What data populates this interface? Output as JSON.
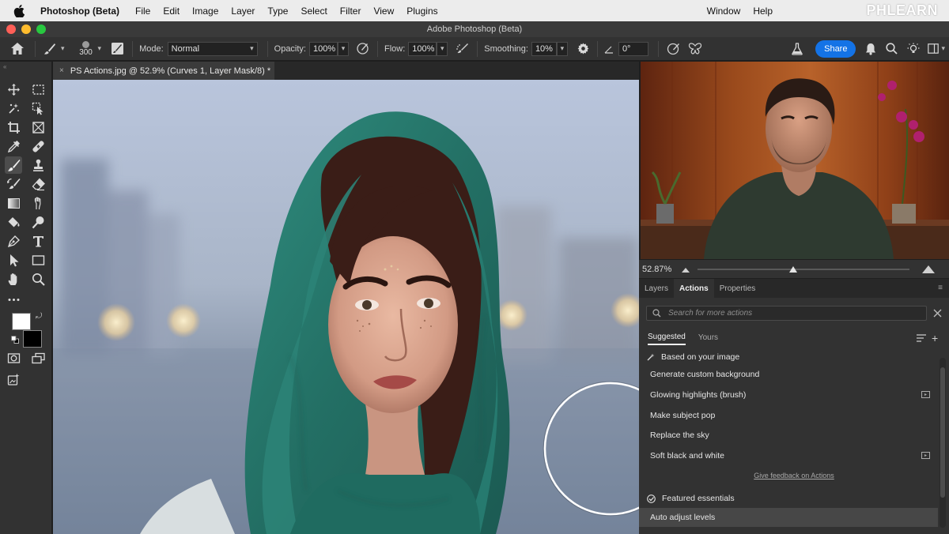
{
  "menubar": {
    "app_name": "Photoshop (Beta)",
    "items": [
      "File",
      "Edit",
      "Image",
      "Layer",
      "Type",
      "Select",
      "Filter",
      "View",
      "Plugins"
    ],
    "right_items": [
      "Window",
      "Help"
    ],
    "brand": "PHLEARN"
  },
  "window": {
    "title": "Adobe Photoshop (Beta)"
  },
  "options_bar": {
    "brush_size": "300",
    "mode_label": "Mode:",
    "mode_value": "Normal",
    "opacity_label": "Opacity:",
    "opacity_value": "100%",
    "flow_label": "Flow:",
    "flow_value": "100%",
    "smoothing_label": "Smoothing:",
    "smoothing_value": "10%",
    "angle_value": "0°",
    "share_label": "Share"
  },
  "document": {
    "tab_title": "PS Actions.jpg @ 52.9% (Curves 1, Layer Mask/8) *",
    "close_glyph": "×"
  },
  "zoom": {
    "value": "52.87%"
  },
  "panel": {
    "tabs": [
      "Layers",
      "Actions",
      "Properties"
    ],
    "active_tab": "Actions",
    "search_placeholder": "Search for more actions",
    "subtabs": [
      "Suggested",
      "Yours"
    ],
    "section_title": "Based on your image",
    "actions": [
      "Generate custom background",
      "Glowing highlights (brush)",
      "Make subject pop",
      "Replace the sky",
      "Soft black and white"
    ],
    "feedback": "Give feedback on Actions",
    "featured_title": "Featured essentials",
    "featured_actions": [
      "Auto adjust levels"
    ]
  },
  "colors": {
    "accent": "#1473e6",
    "panel_bg": "#323232",
    "menubar_bg": "#ececec",
    "traffic_red": "#ff5f57",
    "traffic_yellow": "#febc2e",
    "traffic_green": "#28c840"
  }
}
